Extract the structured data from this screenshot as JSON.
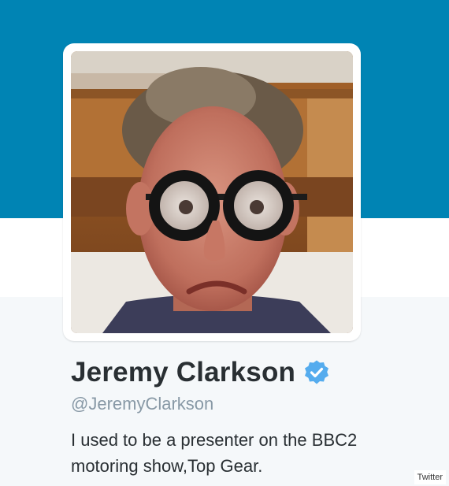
{
  "profile": {
    "name": "Jeremy Clarkson",
    "screen_name": "@JeremyClarkson",
    "verified": true,
    "bio_line1": "I used to be a presenter on the BBC2",
    "bio_line2": "motoring show,Top Gear."
  },
  "credit": "Twitter",
  "colors": {
    "banner": "#0084b4",
    "verified_badge": "#55acee",
    "name_text": "#292f33",
    "screen_name_text": "#8899a6"
  }
}
